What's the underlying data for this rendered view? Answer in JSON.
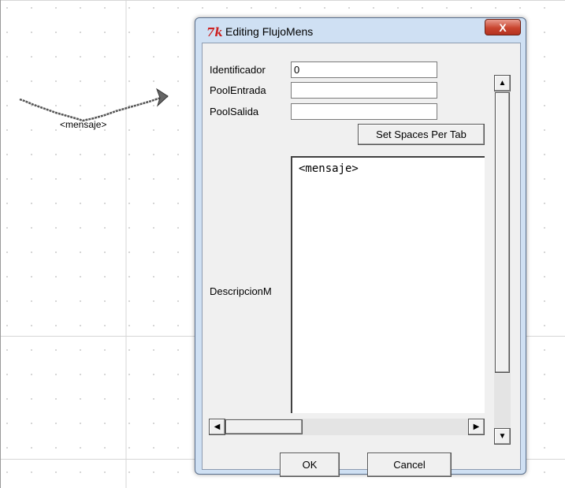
{
  "canvas": {
    "message_label": "<mensaje>"
  },
  "dialog": {
    "title": "Editing FlujoMens",
    "close_glyph": "X",
    "app_icon_glyph": "7k",
    "icons": {
      "app": "tk-feather-icon",
      "close": "close-icon",
      "scroll_up": "arrow-up-icon",
      "scroll_down": "arrow-down-icon",
      "scroll_left": "arrow-left-icon",
      "scroll_right": "arrow-right-icon"
    },
    "fields": {
      "identificador": {
        "label": "Identificador",
        "value": "0"
      },
      "pool_entrada": {
        "label": "PoolEntrada",
        "value": ""
      },
      "pool_salida": {
        "label": "PoolSalida",
        "value": ""
      }
    },
    "set_spaces_label": "Set Spaces Per Tab",
    "descripcion": {
      "label": "DescripcionM",
      "text": "<mensaje>"
    },
    "ok_label": "OK",
    "cancel_label": "Cancel"
  },
  "colors": {
    "dialog_frame": "#cfe0f3",
    "close_button": "#c9452f",
    "grid_line": "#d6d6d6"
  }
}
